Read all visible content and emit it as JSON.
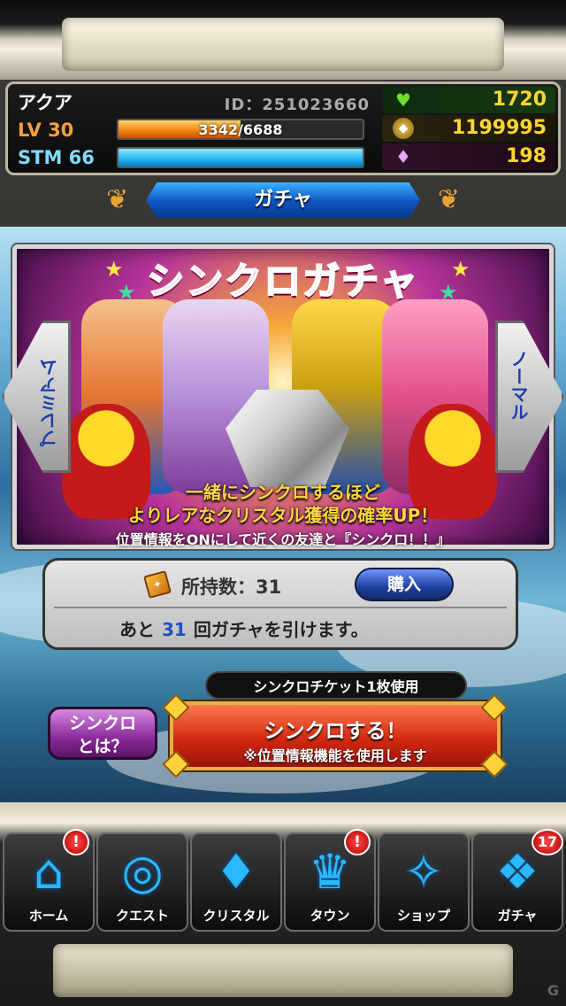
{
  "player": {
    "name": "アクア",
    "id_text": "ID：251023660",
    "level_label": "LV",
    "level": "30",
    "exp_text": "3342/6688",
    "exp_fraction": 0.5,
    "stamina_label": "STM",
    "stamina": "66",
    "stamina_fraction": 1.0
  },
  "resources": {
    "hearts": "1720",
    "coins": "1199995",
    "crystals": "198"
  },
  "header": {
    "title": "ガチャ"
  },
  "gacha": {
    "banner_title": "シンクロガチャ",
    "left_nav": "プレミアム",
    "right_nav": "ノーマル",
    "desc_line1": "一緒にシンクロするほど",
    "desc_line2": "よりレアなクリスタル獲得の確率UP！",
    "desc_line3": "位置情報をONにして近くの友達と『シンクロ！！』"
  },
  "ticket": {
    "owned_label": "所持数：31",
    "buy_label": "購入",
    "remain_prefix": "あと",
    "remain_count": "31",
    "remain_suffix": "回ガチャを引けます。",
    "use_label": "シンクロチケット1枚使用"
  },
  "buttons": {
    "what_is_sync_line1": "シンクロ",
    "what_is_sync_line2": "とは？",
    "sync_main": "シンクロする！",
    "sync_sub": "※位置情報機能を使用します"
  },
  "nav": [
    {
      "label": "ホーム",
      "icon": "home-icon",
      "badge": "!"
    },
    {
      "label": "クエスト",
      "icon": "compass-icon",
      "badge": ""
    },
    {
      "label": "クリスタル",
      "icon": "diamond-icon",
      "badge": ""
    },
    {
      "label": "タウン",
      "icon": "crown-sign-icon",
      "badge": "!"
    },
    {
      "label": "ショップ",
      "icon": "crystal-shop-icon",
      "badge": ""
    },
    {
      "label": "ガチャ",
      "icon": "gacha-crystal-icon",
      "badge": "17"
    }
  ],
  "colors": {
    "accent_blue": "#2ab8ff",
    "gold_text": "#ffd631",
    "banner_pink": "#ff2a7a",
    "sync_red": "#d22a10"
  }
}
